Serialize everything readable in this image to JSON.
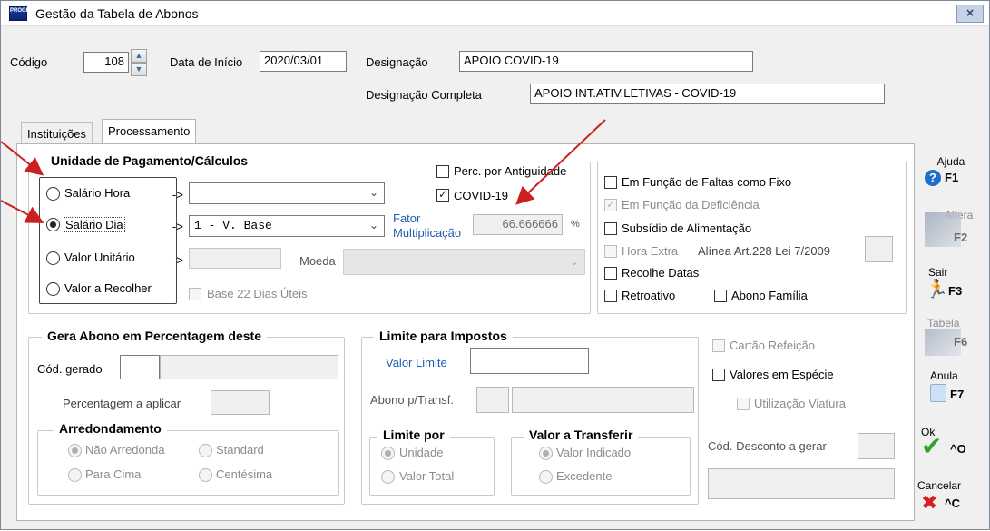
{
  "window": {
    "title": "Gestão da Tabela de Abonos",
    "close_label": "×",
    "icon_text": "PROGRAM"
  },
  "header": {
    "codigo_label": "Código",
    "codigo_value": "108",
    "data_inicio_label": "Data de Início",
    "data_inicio_value": "2020/03/01",
    "designacao_label": "Designação",
    "designacao_value": "APOIO COVID-19",
    "designacao_completa_label": "Designação Completa",
    "designacao_completa_value": "APOIO INT.ATIV.LETIVAS - COVID-19"
  },
  "tabs": [
    {
      "label": "Instituições"
    },
    {
      "label": "Processamento"
    }
  ],
  "unidade": {
    "title": "Unidade de Pagamento/Cálculos",
    "radios": [
      {
        "label": "Salário Hora",
        "selected": false
      },
      {
        "label": "Salário Dia",
        "selected": true
      },
      {
        "label": "Valor Unitário",
        "selected": false
      },
      {
        "label": "Valor a Recolher",
        "selected": false
      }
    ],
    "arrow": "->",
    "combo_hora_value": "",
    "combo_dia_value": "1 - V. Base",
    "valor_unitario_value": "",
    "moeda_label": "Moeda",
    "moeda_value": "",
    "base22_label": "Base 22 Dias Úteis",
    "perc_antiguidade_label": "Perc. por Antiguidade",
    "covid_label": "COVID-19",
    "fator_label_1": "Fator",
    "fator_label_2": "Multiplicação",
    "fator_value": "66.666666",
    "percent_sign": "%"
  },
  "right_checks": {
    "faltas_fixo": "Em Função de Faltas como Fixo",
    "deficiencia": "Em Função da Deficiência",
    "subsidio": "Subsídio de Alimentação",
    "hora_extra": "Hora Extra",
    "alinea": "Alínea Art.228  Lei 7/2009",
    "recolhe_datas": "Recolhe Datas",
    "retroativo": "Retroativo",
    "abono_familia": "Abono Família"
  },
  "gera_abono": {
    "title": "Gera Abono em Percentagem deste",
    "cod_gerado_label": "Cód. gerado",
    "percentagem_label": "Percentagem a  aplicar",
    "arredondamento_title": "Arredondamento",
    "options": [
      "Não Arredonda",
      "Standard",
      "Para Cima",
      "Centésima"
    ]
  },
  "limite_impostos": {
    "title": "Limite para Impostos",
    "valor_limite_label": "Valor Limite",
    "abono_transf_label": "Abono p/Transf.",
    "limite_por_title": "Limite por",
    "limite_por_options": [
      "Unidade",
      "Valor Total"
    ],
    "valor_transferir_title": "Valor a Transferir",
    "valor_transferir_options": [
      "Valor Indicado",
      "Excedente"
    ]
  },
  "extra": {
    "cartao_refeicao": "Cartão Refeição",
    "valores_especie": "Valores em Espécie",
    "utilizacao_viatura": "Utilização Viatura",
    "cod_desconto_label": "Cód. Desconto a gerar"
  },
  "side_buttons": [
    {
      "caption": "Ajuda",
      "key": "F1"
    },
    {
      "caption": "Altera",
      "key": "F2"
    },
    {
      "caption": "Sair",
      "key": "F3"
    },
    {
      "caption": "Tabela",
      "key": "F6"
    },
    {
      "caption": "Anula",
      "key": "F7"
    },
    {
      "caption": "Ok",
      "key": "^O"
    },
    {
      "caption": "Cancelar",
      "key": "^C"
    }
  ],
  "colors": {
    "annotation_arrow": "#cc1f1f",
    "help_blue": "#1f6fc9",
    "ok_green": "#2ea32e",
    "cancel_red": "#d42020"
  }
}
